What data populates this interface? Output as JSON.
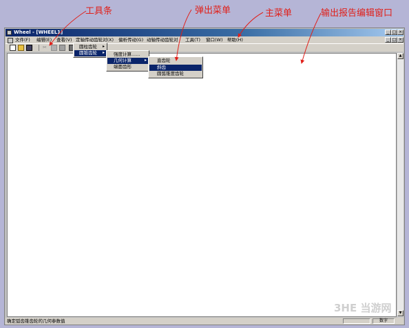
{
  "annotations": {
    "toolbar": "工具条",
    "popup_menu": "弹出菜单",
    "main_menu": "主菜单",
    "output_window": "输出报告编辑窗口"
  },
  "window": {
    "title": "Wheel - [WHEEL1]"
  },
  "menubar": {
    "items": [
      "文件(F)",
      "编辑(E)",
      "查看(V)",
      "定轴传动齿轮对(X)",
      "偏析传动(G)",
      "动轴传动齿轮对",
      "工具(T)",
      "窗口(W)",
      "帮助(H)"
    ]
  },
  "menu_level1": {
    "items": [
      "圆柱齿轮",
      "圆锥齿轮"
    ]
  },
  "menu_level2": {
    "items": [
      "强度计算......",
      "几何计算",
      "端面齿形"
    ]
  },
  "menu_level3": {
    "items": [
      "直齿轮",
      "斜齿",
      "圆弧锥度齿轮"
    ],
    "selected": "斜齿"
  },
  "status": {
    "text": "确定弧齿锥齿轮的几何参数值",
    "panel": "数字"
  },
  "watermark": "3HE 当游网"
}
